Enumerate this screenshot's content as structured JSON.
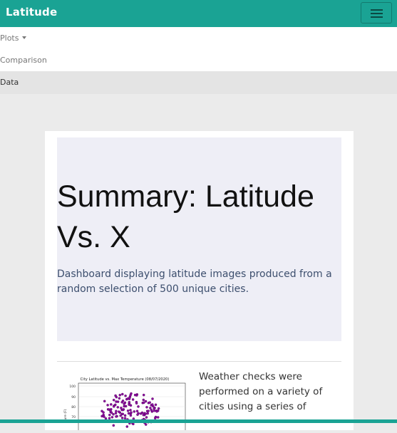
{
  "navbar": {
    "brand": "Latitude",
    "toggler_icon": "hamburger-icon"
  },
  "menu": {
    "items": [
      {
        "label": "Plots",
        "has_dropdown": true
      },
      {
        "label": "Comparison"
      },
      {
        "label": "Data",
        "active": true
      }
    ]
  },
  "content": {
    "title_line1": "Summary: Latitude",
    "title_line2": "Vs. X",
    "lead": "Dashboard displaying latitude images produced from a random selection of 500 unique cities.",
    "description": "Weather checks were performed on a variety of cities using a series of"
  },
  "thumbnail": {
    "title": "City Latitude vs. Max Temperature (08/07/2020)",
    "ylabel": "ature (F)",
    "yticks": [
      "100",
      "90",
      "80",
      "70"
    ]
  },
  "colors": {
    "primary": "#1aa394",
    "marker": "#8b0a9e"
  }
}
